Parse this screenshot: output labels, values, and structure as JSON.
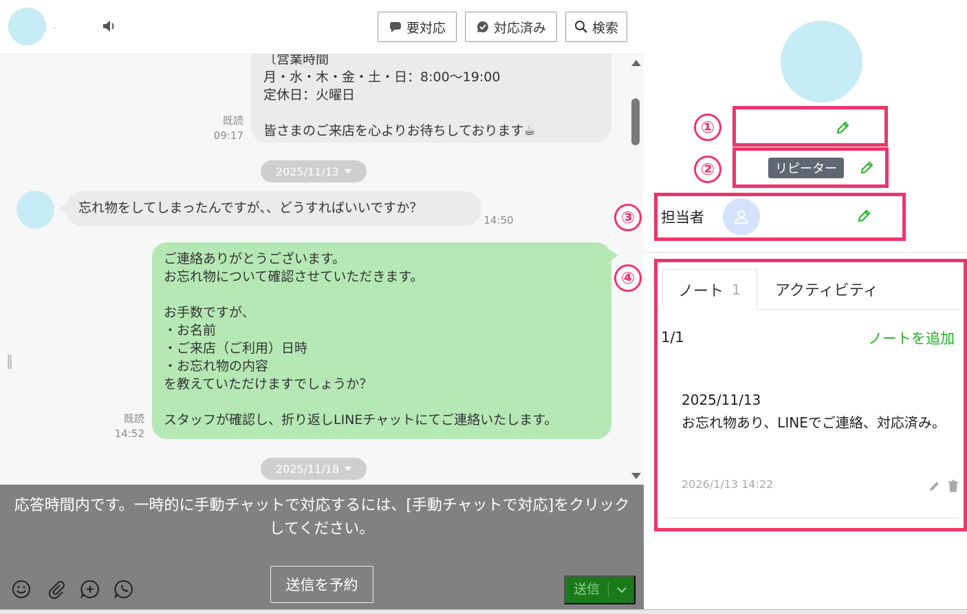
{
  "header": {
    "buttons": {
      "needs_action": "要対応",
      "resolved": "対応済み",
      "search": "検索"
    }
  },
  "messages": {
    "m1": {
      "lines": [
        "月・水・木・金・土・日：8:00〜19:00",
        "定休日：火曜日",
        "皆さまのご来店を心よりお待ちしております☕"
      ],
      "partial_top": "〔営業時間",
      "read": "既読",
      "time": "09:17"
    },
    "date1": "2025/11/13",
    "m2": {
      "text": "忘れ物をしてしまったんですが、、どうすればいいですか？",
      "time": "14:50"
    },
    "m3": {
      "text": "ご連絡ありがとうございます。\nお忘れ物について確認させていただきます。\n\nお手数ですが、\n・お名前\n・ご来店（ご利用）日時\n・お忘れ物の内容\nを教えていただけますでしょうか？\n\nスタッフが確認し、折り返しLINEチャットにてご連絡いたします。",
      "read": "既読",
      "time": "14:52"
    },
    "date2": "2025/11/18"
  },
  "footer": {
    "notice": "応答時間内です。一時的に手動チャットで対応するには、[手動チャットで対応]をクリックしてください。",
    "schedule_button": "送信を予約",
    "send_button": "送信"
  },
  "side": {
    "numbers": [
      "①",
      "②",
      "③",
      "④"
    ],
    "tag": "リピーター",
    "assignee_label": "担当者",
    "tabs": {
      "notes": "ノート",
      "notes_count": "1",
      "activity": "アクティビティ"
    },
    "page_indicator": "1/1",
    "add_note": "ノートを追加",
    "note": {
      "date": "2025/11/13",
      "text": "お忘れ物あり、LINEでご連絡、対応済み。",
      "timestamp": "2026/1/13 14:22"
    }
  },
  "colors": {
    "highlight": "#f0336b",
    "bubble_out": "#b5e8b5",
    "bubble_in": "#ebebeb",
    "send_button": "#1a7a1a",
    "add_note_link": "#1fb31f",
    "avatar": "#c6ecf6"
  }
}
